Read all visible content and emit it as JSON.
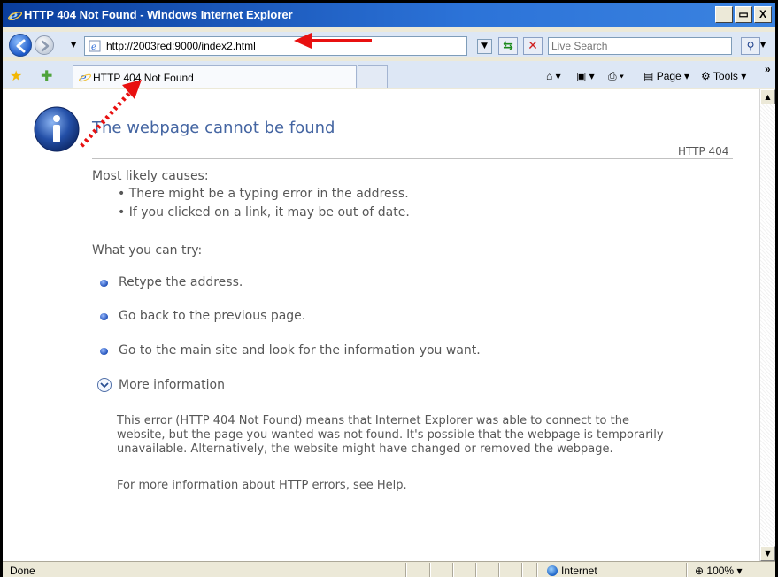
{
  "window": {
    "title": "HTTP 404 Not Found - Windows Internet Explorer",
    "controls": [
      "_",
      "▭",
      "X"
    ]
  },
  "address_bar": {
    "url": "http://2003red:9000/index2.html",
    "search_placeholder": "Live Search"
  },
  "tab": {
    "label": "HTTP 404 Not Found"
  },
  "command_bar": {
    "page_label": "Page",
    "tools_label": "Tools",
    "chevron": "»"
  },
  "page": {
    "heading": "The webpage cannot be found",
    "code": "HTTP 404",
    "causes_title": "Most likely causes:",
    "causes": [
      "There might be a typing error in the address.",
      "If you clicked on a link, it may be out of date."
    ],
    "try_title": "What you can try:",
    "try_items": [
      "Retype the address.",
      "Go back to the previous page.",
      "Go to the main site and look for the information you want."
    ],
    "more_info_label": "More information",
    "more_info_para_lines": [
      "This error (HTTP 404 Not Found) means that Internet Explorer was able to connect to the",
      "website, but the page you wanted was not found. It's possible that the webpage is temporarily",
      "unavailable. Alternatively, the website might have changed or removed the webpage."
    ],
    "help_line": "For more information about HTTP errors, see Help."
  },
  "status_bar": {
    "status": "Done",
    "zone": "Internet",
    "zoom": "100%"
  },
  "colors": {
    "heading": "#4465a2",
    "annotation": "#e81010"
  }
}
